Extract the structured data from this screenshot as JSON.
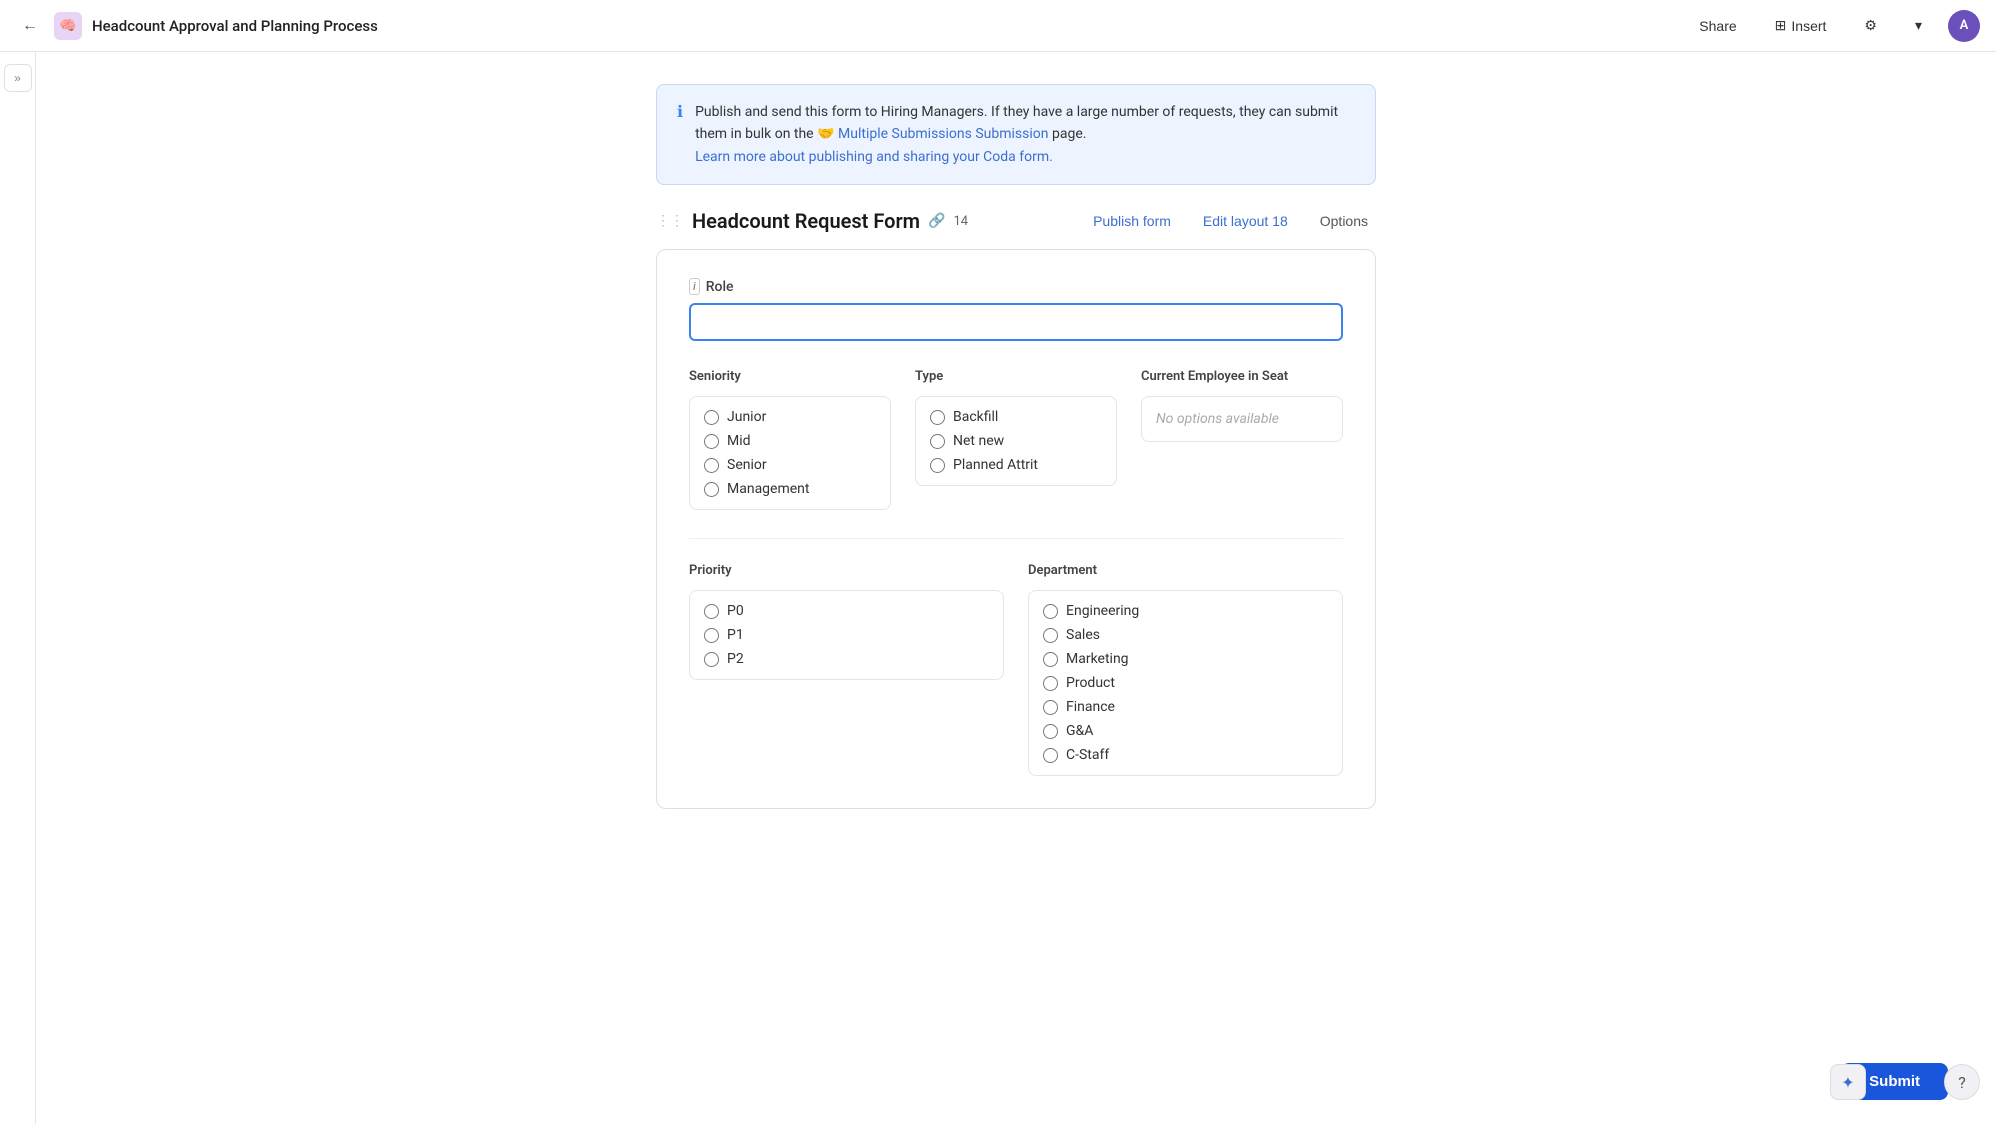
{
  "topnav": {
    "back_label": "←",
    "doc_emoji": "🧠",
    "doc_title": "Headcount Approval and Planning Process",
    "share_label": "Share",
    "insert_label": "Insert",
    "insert_icon": "⊞",
    "settings_icon": "⚙",
    "chevron_icon": "▾",
    "avatar_initials": "A"
  },
  "sidebar": {
    "toggle_icon": "»"
  },
  "info_banner": {
    "icon": "ℹ",
    "text_1": "Publish and send this form to Hiring Managers. If they have a large number of requests, they can submit them in bulk on the ",
    "link_emoji": "🤝",
    "link_text": "Multiple Submissions Submission",
    "text_2": " page.",
    "learn_more_text": "Learn more about publishing and sharing your Coda form.",
    "learn_more_href": "#"
  },
  "form_section": {
    "drag_icon": "⋮⋮",
    "title": "Headcount Request Form",
    "link_icon": "🔗",
    "count": "14",
    "publish_label": "Publish form",
    "edit_label": "Edit layout",
    "edit_count": "18",
    "options_label": "Options"
  },
  "role_field": {
    "label": "Role",
    "label_icon": "i",
    "placeholder": ""
  },
  "seniority": {
    "label": "Seniority",
    "options": [
      {
        "label": "Junior",
        "value": "junior"
      },
      {
        "label": "Mid",
        "value": "mid"
      },
      {
        "label": "Senior",
        "value": "senior"
      },
      {
        "label": "Management",
        "value": "management"
      }
    ]
  },
  "type": {
    "label": "Type",
    "options": [
      {
        "label": "Backfill",
        "value": "backfill"
      },
      {
        "label": "Net new",
        "value": "net_new"
      },
      {
        "label": "Planned Attrit",
        "value": "planned_attrit"
      }
    ]
  },
  "current_employee": {
    "label": "Current Employee in Seat",
    "no_options_text": "No options available"
  },
  "priority": {
    "label": "Priority",
    "options": [
      {
        "label": "P0",
        "value": "p0"
      },
      {
        "label": "P1",
        "value": "p1"
      },
      {
        "label": "P2",
        "value": "p2"
      }
    ]
  },
  "department": {
    "label": "Department",
    "options": [
      {
        "label": "Engineering",
        "value": "engineering"
      },
      {
        "label": "Sales",
        "value": "sales"
      },
      {
        "label": "Marketing",
        "value": "marketing"
      },
      {
        "label": "Product",
        "value": "product"
      },
      {
        "label": "Finance",
        "value": "finance"
      },
      {
        "label": "G&A",
        "value": "gna"
      },
      {
        "label": "C-Staff",
        "value": "cstaff"
      }
    ]
  },
  "submit": {
    "label": "Submit"
  },
  "sparkle_icon": "✦",
  "help_icon": "?"
}
